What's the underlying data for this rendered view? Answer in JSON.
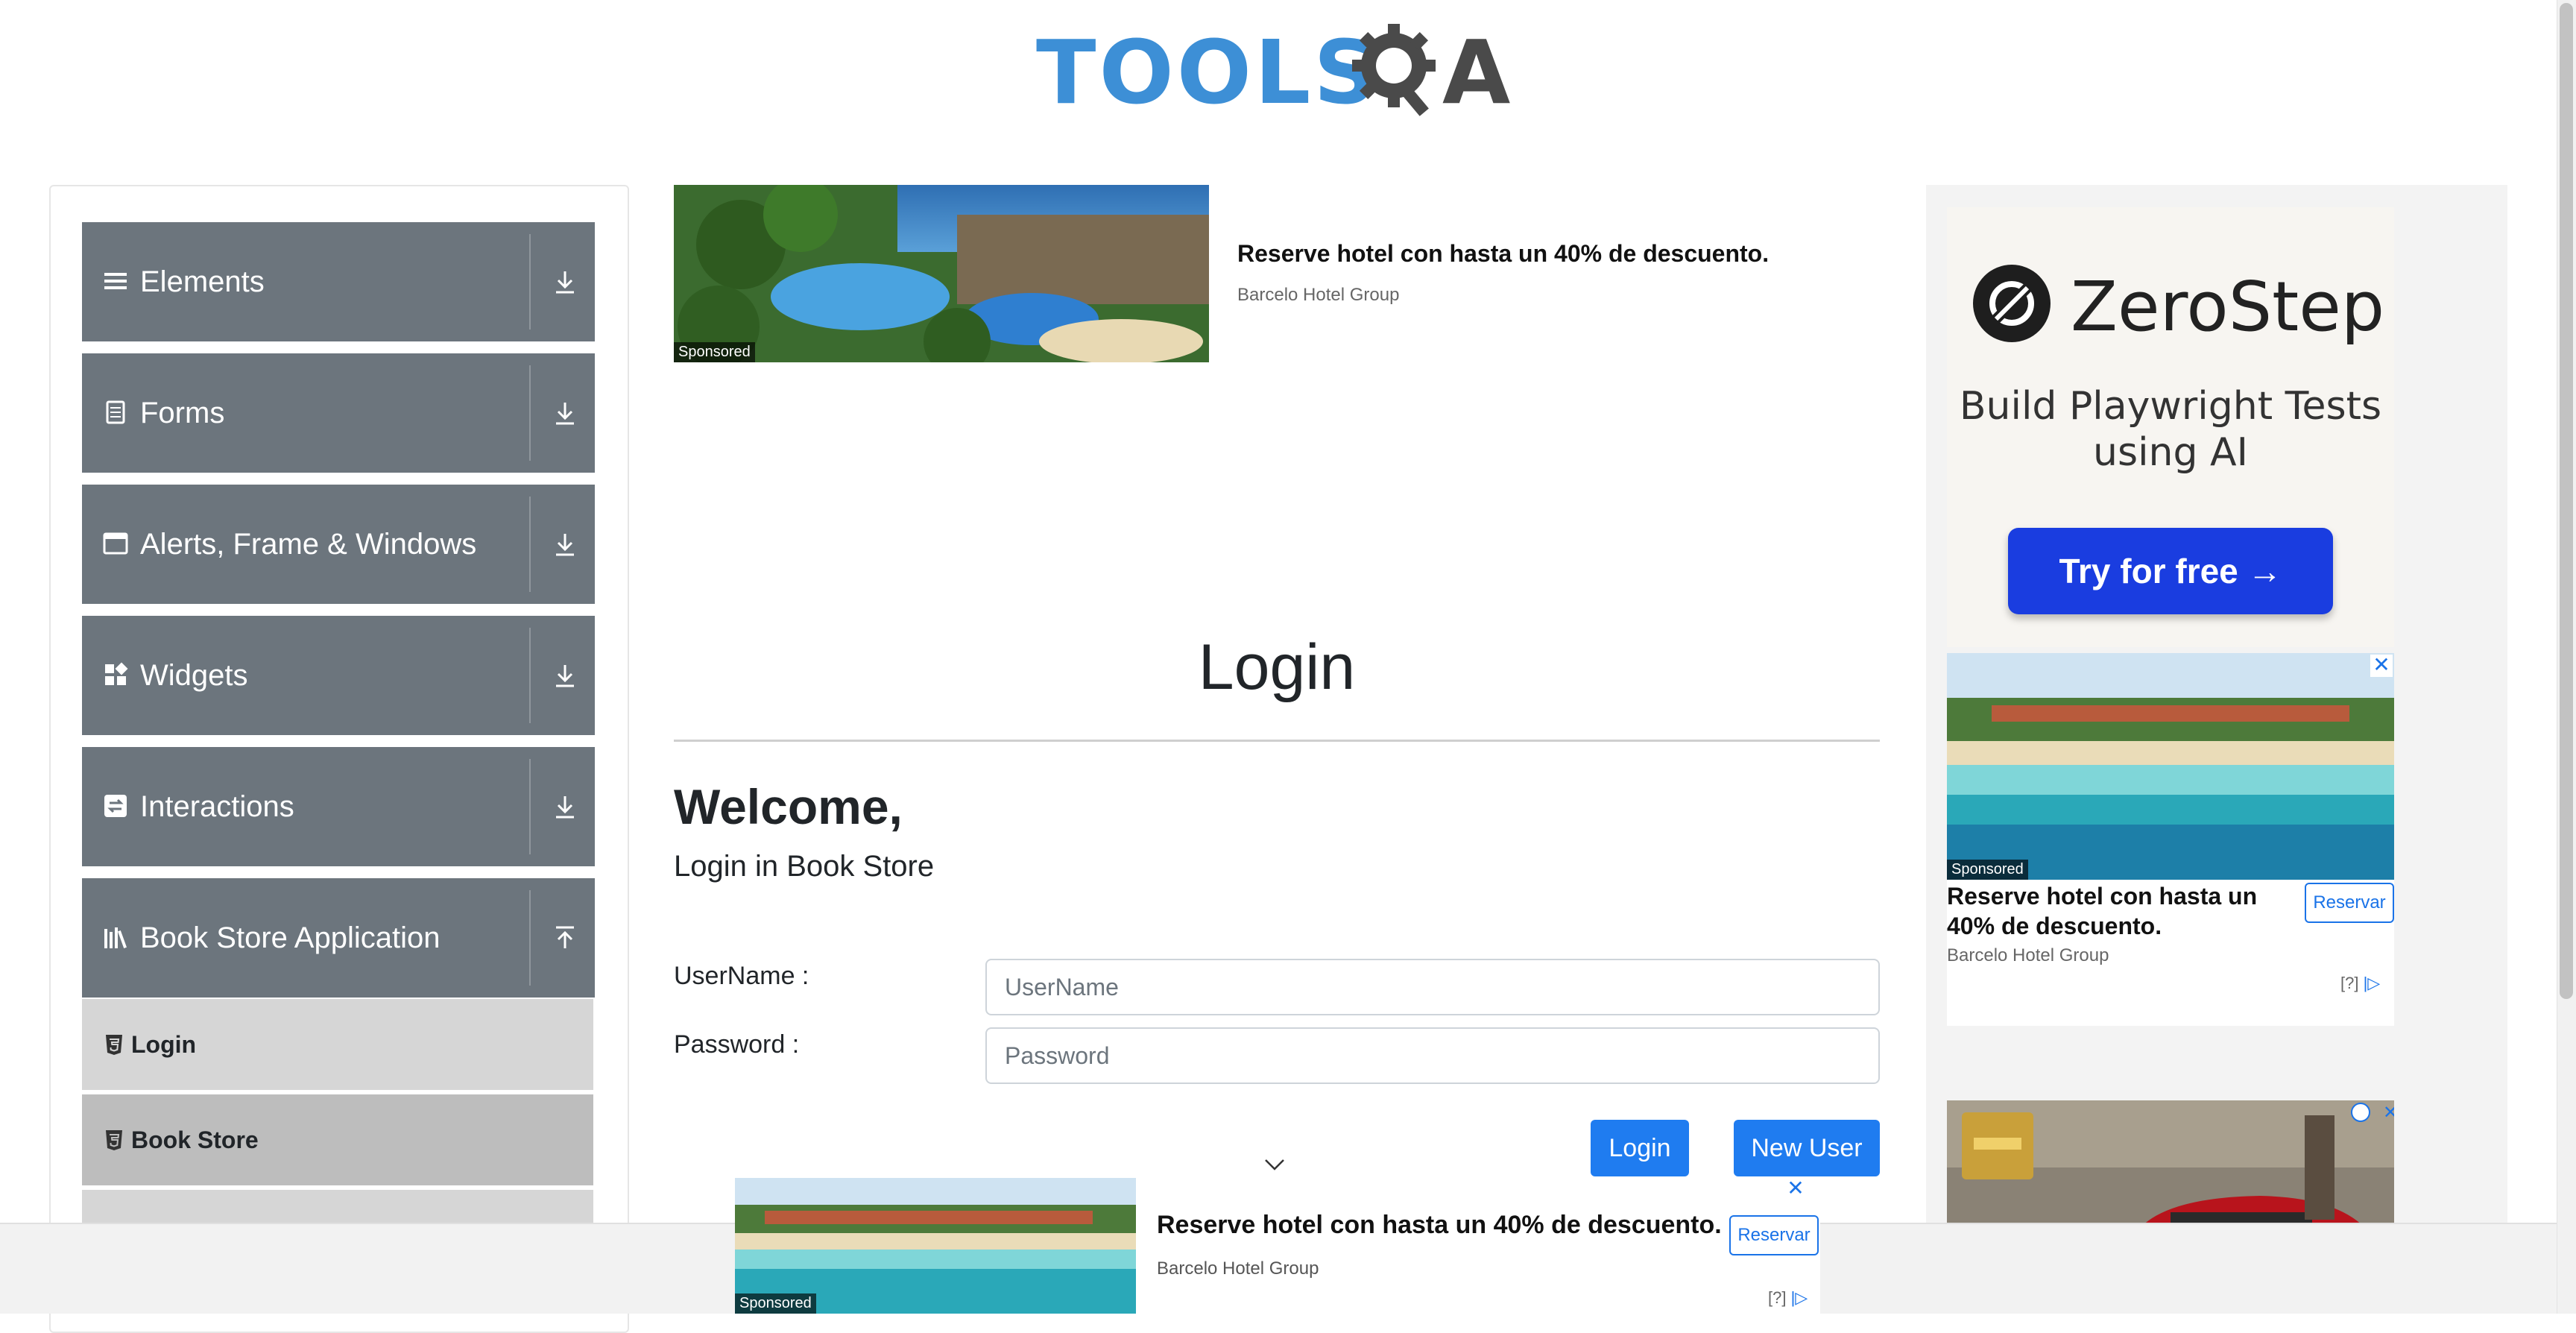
{
  "header": {
    "logo_text_left": "TOOLS",
    "logo_text_right": "A",
    "logo_gear_letter": "Q"
  },
  "sidebar": {
    "groups": [
      {
        "label": "Elements",
        "icon": "hamburger-icon"
      },
      {
        "label": "Forms",
        "icon": "document-icon"
      },
      {
        "label": "Alerts, Frame & Windows",
        "icon": "window-icon"
      },
      {
        "label": "Widgets",
        "icon": "widgets-icon"
      },
      {
        "label": "Interactions",
        "icon": "interactions-icon"
      },
      {
        "label": "Book Store Application",
        "icon": "books-icon"
      }
    ],
    "sub_items": [
      {
        "label": "Login"
      },
      {
        "label": "Book Store"
      }
    ]
  },
  "top_ad": {
    "title": "Reserve hotel con hasta un 40% de descuento.",
    "brand": "Barcelo Hotel Group",
    "sponsored": "Sponsored"
  },
  "main": {
    "page_title": "Login",
    "welcome": "Welcome,",
    "subtitle": "Login in Book Store",
    "username_label": "UserName :",
    "username_placeholder": "UserName",
    "username_value": "",
    "password_label": "Password :",
    "password_placeholder": "Password",
    "password_value": "",
    "login_button": "Login",
    "new_user_button": "New User"
  },
  "right_ads": {
    "zerostep": {
      "brand": "ZeroStep",
      "headline": "Build Playwright Tests using AI",
      "cta": "Try for free →"
    },
    "hotel": {
      "sponsored": "Sponsored",
      "title": "Reserve hotel con hasta un 40% de descuento.",
      "brand": "Barcelo Hotel Group",
      "button": "Reservar",
      "adchoices": "[?]"
    }
  },
  "bottom_ad": {
    "sponsored": "Sponsored",
    "title": "Reserve hotel con hasta un 40% de descuento.",
    "brand": "Barcelo Hotel Group",
    "button": "Reservar",
    "adchoices": "[?]"
  },
  "colors": {
    "sidebar_group_bg": "#6c757d",
    "sidebar_sub_bg": "#d6d6d6",
    "primary_button": "#1f7cf0",
    "logo_blue": "#3d8fd6",
    "zerostep_cta": "#1a3de0"
  }
}
